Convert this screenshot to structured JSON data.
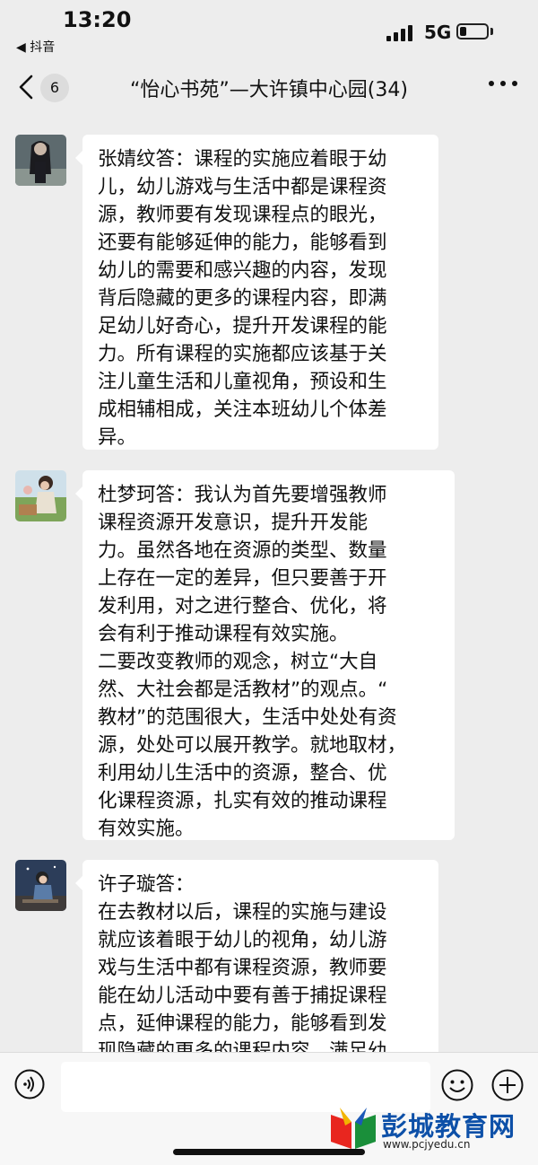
{
  "status": {
    "time": "13:20",
    "back_app": "◀ 抖音",
    "network": "5G"
  },
  "nav": {
    "back_count": "6",
    "title": "“怡心书苑”—大许镇中心园(34)"
  },
  "messages": [
    {
      "avatar_icon": "avatar-girl-dark",
      "text": "张婧纹答：课程的实施应着眼于幼\n儿，幼儿游戏与生活中都是课程资\n源，教师要有发现课程点的眼光，\n还要有能够延伸的能力，能够看到\n幼儿的需要和感兴趣的内容，发现\n背后隐藏的更多的课程内容，即满\n足幼儿好奇心，提升开发课程的能\n力。所有课程的实施都应该基于关\n注儿童生活和儿童视角，预设和生\n成相辅相成，关注本班幼儿个体差\n异。"
    },
    {
      "avatar_icon": "avatar-girl-field",
      "text": "杜梦珂答：我认为首先要增强教师\n课程资源开发意识，提升开发能\n力。虽然各地在资源的类型、数量\n上存在一定的差异，但只要善于开\n发利用，对之进行整合、优化，将\n会有利于推动课程有效实施。\n二要改变教师的观念，树立“大自\n然、大社会都是活教材”的观点。“\n教材”的范围很大，生活中处处有资\n源，处处可以展开教学。就地取材，\n利用幼儿生活中的资源，整合、优\n化课程资源，扎实有效的推动课程\n有效实施。"
    },
    {
      "avatar_icon": "avatar-girl-night",
      "text": "许子璇答：\n在去教材以后，课程的实施与建设\n就应该着眼于幼儿的视角，幼儿游\n戏与生活中都有课程资源，教师要\n能在幼儿活动中要有善于捕捉课程\n点，延伸课程的能力，能够看到发\n现隐藏的更多的课程内容，满足幼"
    }
  ],
  "input": {
    "placeholder": ""
  },
  "watermark": {
    "name": "彭城教育网",
    "url": "www.pcjyedu.cn"
  },
  "colors": {
    "background": "#ededed",
    "bubble": "#ffffff",
    "watermark_blue": "#0d50a8"
  }
}
